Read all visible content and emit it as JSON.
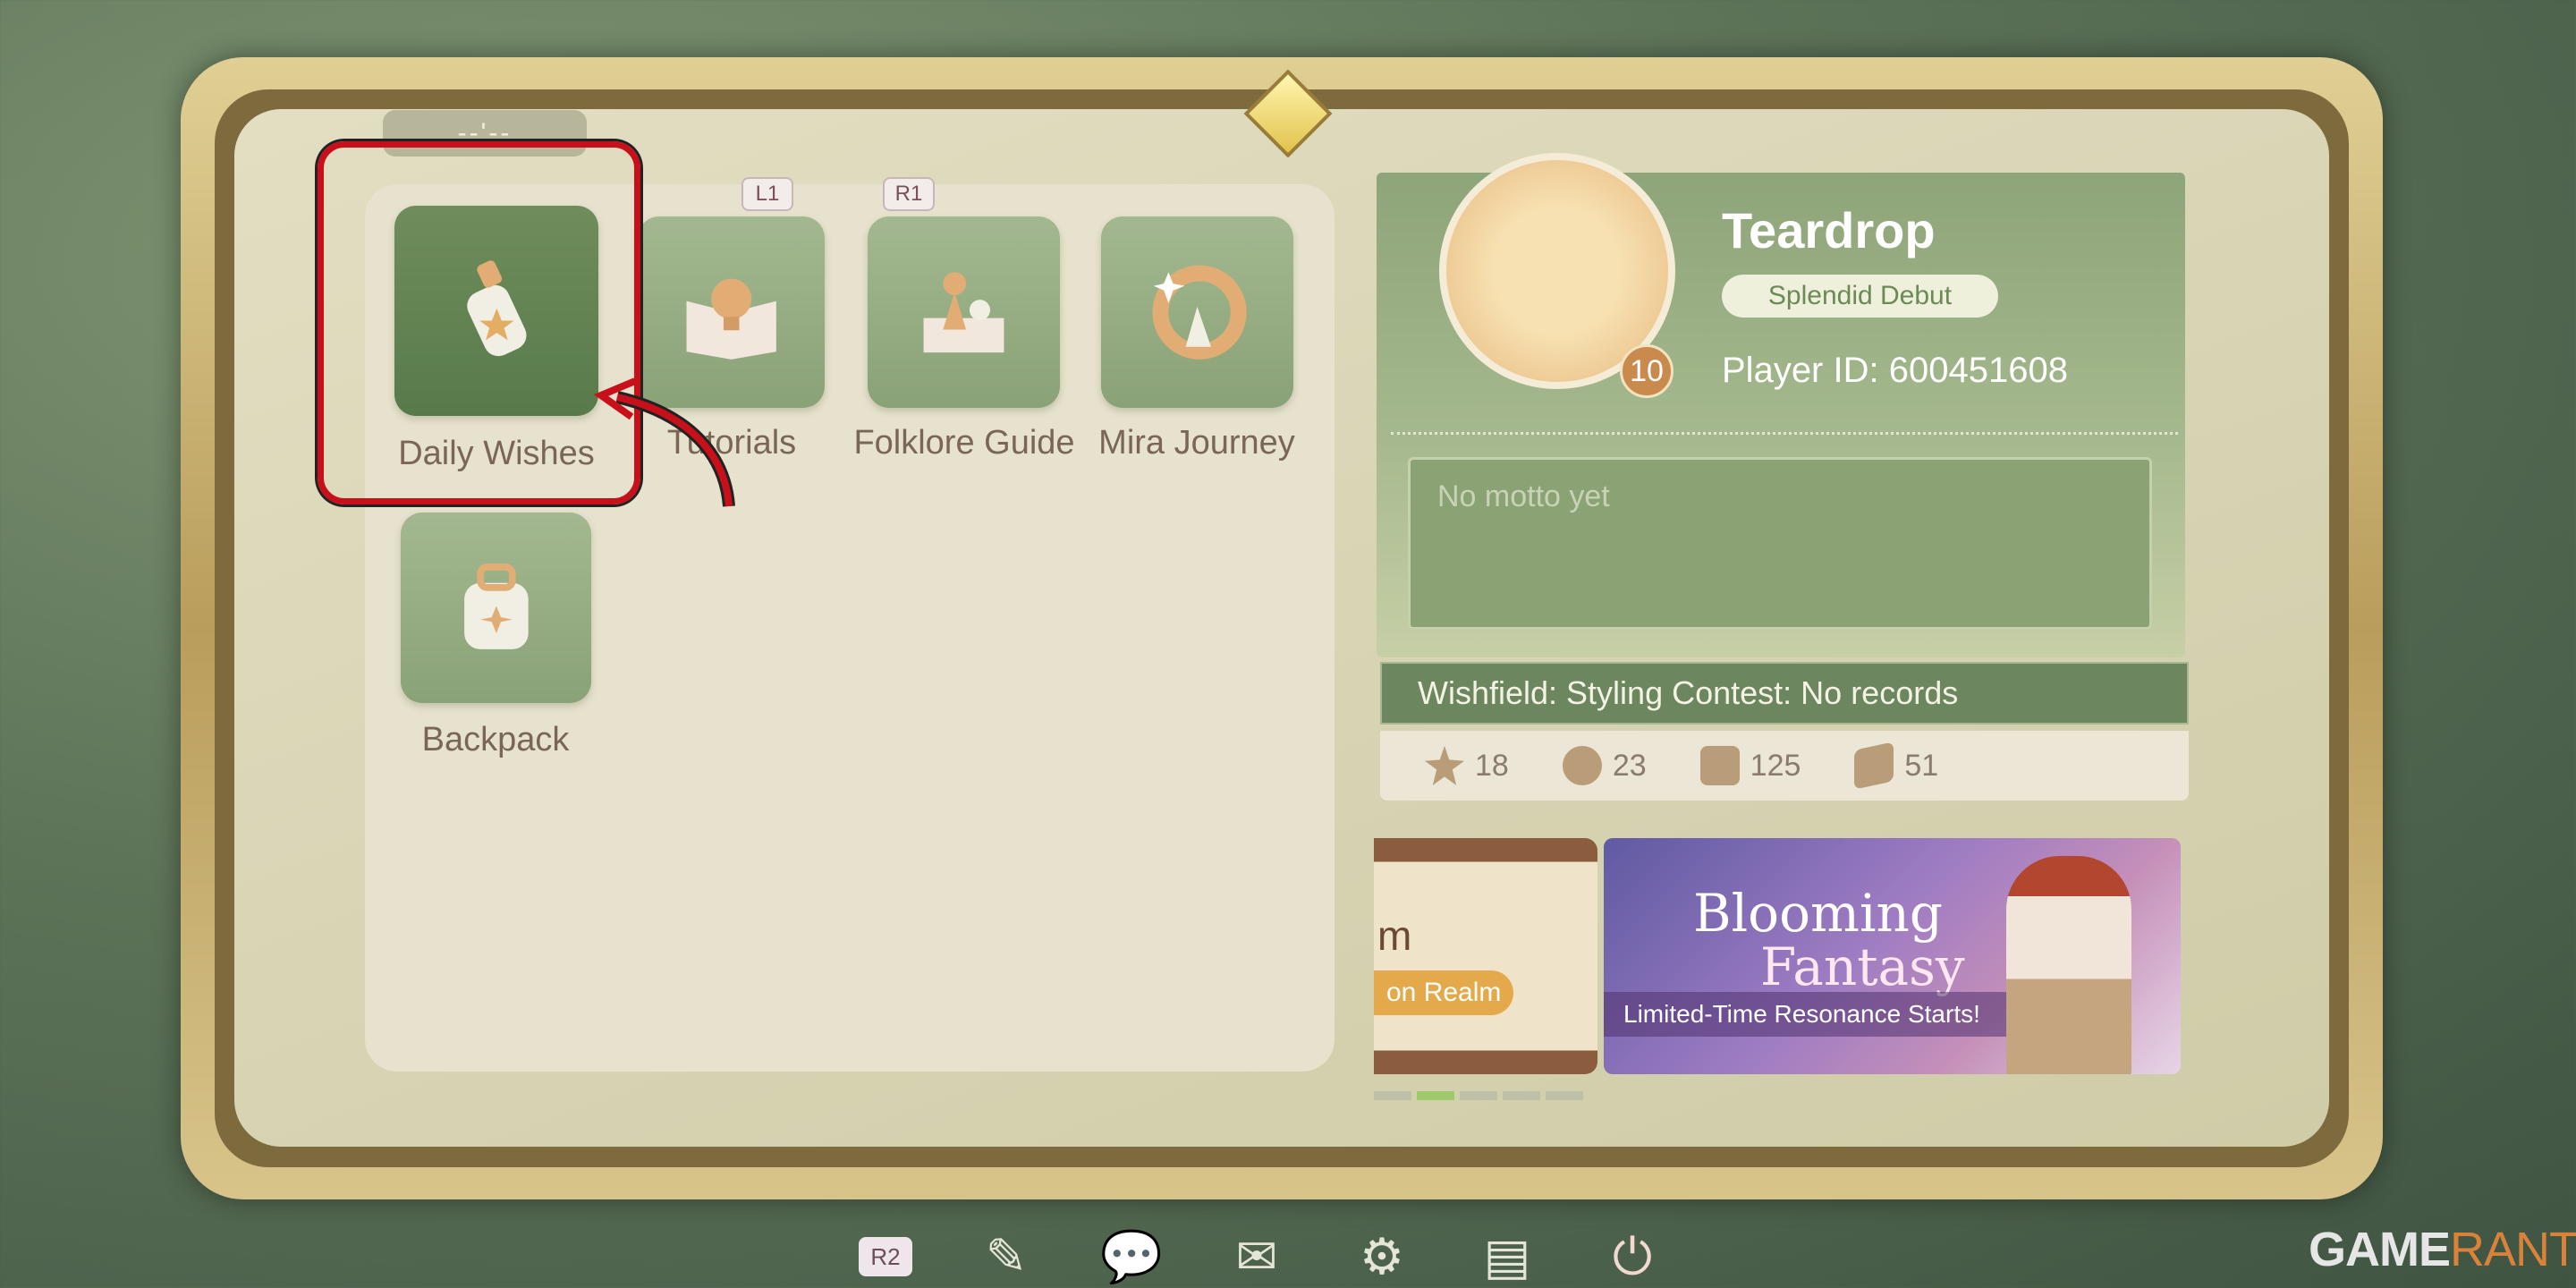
{
  "timer": "--'--",
  "shoulder_buttons": {
    "left": "L1",
    "right": "R1"
  },
  "menu": {
    "items": [
      {
        "label": "Daily Wishes",
        "icon": "wish-bottle-icon",
        "active": true
      },
      {
        "label": "Tutorials",
        "icon": "lightbulb-book-icon"
      },
      {
        "label": "Folklore Guide",
        "icon": "game-piece-icon"
      },
      {
        "label": "Mira Journey",
        "icon": "mira-journey-icon"
      },
      {
        "label": "Backpack",
        "icon": "backpack-icon"
      }
    ]
  },
  "profile": {
    "name": "Teardrop",
    "title": "Splendid Debut",
    "player_id": "Player ID: 600451608",
    "level": "10",
    "motto_placeholder": "No motto yet",
    "wishfield": "Wishfield: Styling Contest: No records",
    "stats": [
      {
        "icon": "star-icon",
        "value": "18"
      },
      {
        "icon": "coin-icon",
        "value": "23"
      },
      {
        "icon": "outfit-icon",
        "value": "125"
      },
      {
        "icon": "ticket-icon",
        "value": "51"
      }
    ]
  },
  "banners": {
    "left_text": "on Realm",
    "left_letter": "m",
    "main_title_1": "Blooming",
    "main_title_2": "Fantasy",
    "main_subtitle": "Limited-Time Resonance Starts!",
    "active_index": 1,
    "count": 5
  },
  "bottom_bar": {
    "r2": "R2",
    "icons": [
      "notes-icon",
      "chat-icon",
      "mail-icon",
      "settings-icon",
      "archive-icon",
      "power-icon"
    ]
  },
  "watermark": {
    "part1": "GAME",
    "part2": "RANT"
  },
  "colors": {
    "highlight": "#c8101a",
    "accent_green": "#6c8660"
  }
}
